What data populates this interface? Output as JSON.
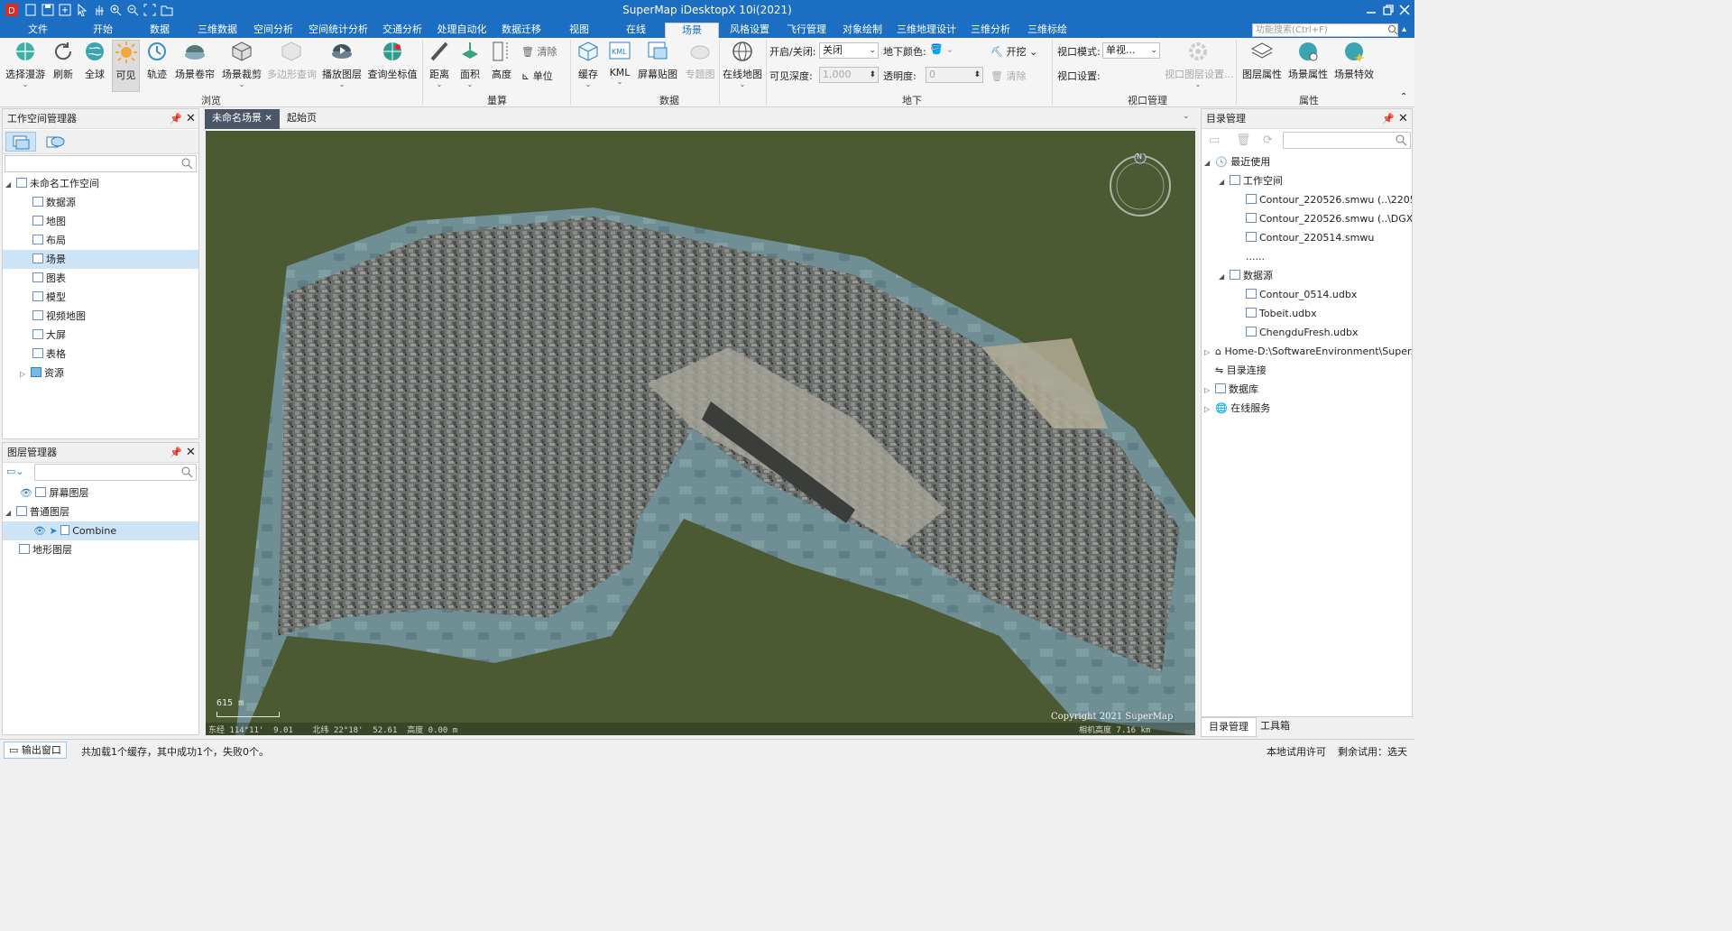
{
  "window": {
    "title": "SuperMap iDesktopX 10i(2021)"
  },
  "menu": {
    "tabs": [
      "文件",
      "开始",
      "数据",
      "三维数据",
      "空间分析",
      "空间统计分析",
      "交通分析",
      "处理自动化",
      "数据迁移",
      "视图",
      "在线",
      "场景",
      "风格设置",
      "飞行管理",
      "对象绘制",
      "三维地理设计",
      "三维分析",
      "三维标绘"
    ],
    "active": "场景",
    "search_placeholder": "功能搜索(Ctrl+F)"
  },
  "ribbon": {
    "browse": {
      "group": "浏览",
      "select_roam": "选择漫游",
      "refresh": "刷新",
      "full_extent": "全球",
      "visible": "可见",
      "track": "轨迹",
      "scene_roll": "场景卷帘",
      "scene_clip": "场景裁剪",
      "polygon_query": "多边形查询",
      "play_layer": "播放图层",
      "query_coord": "查询坐标值"
    },
    "measure": {
      "group": "量算",
      "distance": "距离",
      "area": "面积",
      "height": "高度",
      "clear": "清除",
      "unit": "单位"
    },
    "data": {
      "group": "数据",
      "cache": "缓存",
      "kml": "KML",
      "screen_tile": "屏幕贴图",
      "thematic": "专题图"
    },
    "online": {
      "online_map": "在线地图"
    },
    "underground": {
      "group": "地下",
      "on_off_label": "开启/关闭:",
      "on_off_value": "关闭",
      "color_label": "地下颜色:",
      "excavate": "开挖",
      "depth_label": "可见深度:",
      "depth_value": "1,000",
      "opacity_label": "透明度:",
      "opacity_value": "0",
      "clear": "清除"
    },
    "viewport": {
      "group": "视口管理",
      "mode_label": "视口模式:",
      "mode_value": "单视...",
      "settings_label": "视口设置:",
      "layer_settings": "视口图层设置..."
    },
    "props": {
      "group": "属性",
      "layer_props": "图层属性",
      "scene_props": "场景属性",
      "scene_effects": "场景特效"
    }
  },
  "workspace": {
    "title": "工作空间管理器",
    "root": "未命名工作空间",
    "items": [
      "数据源",
      "地图",
      "布局",
      "场景",
      "图表",
      "模型",
      "视频地图",
      "大屏",
      "表格",
      "资源"
    ],
    "selected": "场景"
  },
  "layers": {
    "title": "图层管理器",
    "items": [
      "屏幕图层",
      "普通图层",
      "Combine",
      "地形图层"
    ]
  },
  "doc_tabs": [
    "未命名场景",
    "起始页"
  ],
  "scene": {
    "scale": "615 m",
    "copyright": "Copyright 2021 SuperMap",
    "status": "东经 114°11'  9.01    北纬 22°18'  52.61  高度 0.00 m",
    "camera": "相机高度 7.16 km",
    "compass": "N"
  },
  "catalog": {
    "title": "目录管理",
    "recent": "最近使用",
    "workspace_label": "工作空间",
    "workspaces": [
      "Contour_220526.smwu (..\\2205...",
      "Contour_220526.smwu (..\\DGX\\..)",
      "Contour_220514.smwu",
      "......"
    ],
    "datasource_label": "数据源",
    "datasources": [
      "Contour_0514.udbx",
      "Tobeit.udbx",
      "ChengduFresh.udbx"
    ],
    "home": "Home-D:\\SoftwareEnvironment\\Super...",
    "dir_conn": "目录连接",
    "database": "数据库",
    "online": "在线服务",
    "bottom_tabs": [
      "目录管理",
      "工具箱"
    ]
  },
  "status": {
    "output_tab": "输出窗口",
    "message": "共加载1个缓存，其中成功1个，失败0个。",
    "right1": "本地试用许可",
    "right2": "剩余试用：选天"
  }
}
